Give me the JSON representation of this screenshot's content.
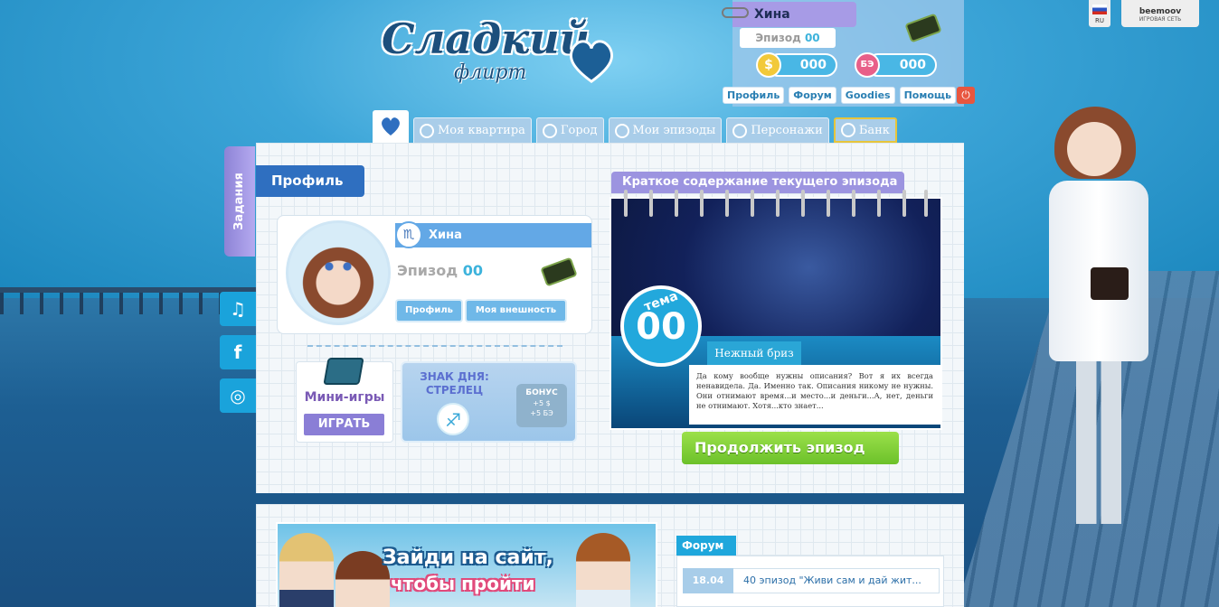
{
  "logo": {
    "title": "Сладкий",
    "subtitle": "флирт"
  },
  "player": {
    "name": "Хина",
    "episode_label": "Эпизод",
    "episode_value": "00",
    "dollars": "000",
    "be": "000",
    "be_icon": "БЭ",
    "coin_icon": "$"
  },
  "top_links": [
    "Профиль",
    "Форум",
    "Goodies",
    "Помощь"
  ],
  "lang": {
    "code": "RU"
  },
  "beemoov": {
    "logo": "beemoov",
    "subtitle": "ИГРОВАЯ СЕТЬ"
  },
  "nav": {
    "tabs": [
      "Моя квартира",
      "Город",
      "Мои эпизоды",
      "Персонажи",
      "Банк"
    ]
  },
  "side": {
    "quests": "Задания",
    "music_icon": "♫",
    "facebook_icon": "f",
    "instagram_icon": "◎"
  },
  "profile": {
    "section_title": "Профиль",
    "name": "Хина",
    "zodiac_icon": "♏",
    "episode_label": "Эпизод",
    "episode_value": "00",
    "btn_profile": "Профиль",
    "btn_appearance": "Моя внешность"
  },
  "minigames": {
    "title": "Мини-игры",
    "play": "ИГРАТЬ"
  },
  "sign": {
    "title_line1": "ЗНАК ДНЯ:",
    "title_line2": "СТРЕЛЕЦ",
    "icon": "♐",
    "bonus_title": "БОНУС",
    "bonus_1": "+5 $",
    "bonus_2": "+5 БЭ"
  },
  "episode": {
    "header": "Краткое содержание текущего эпизода",
    "tema_label": "тема",
    "tema_value": "00",
    "name": "Нежный бриз",
    "description": "Да кому вообще нужны описания? Вот я их всегда ненавидела. Да. Именно так. Описания никому не нужны. Они отнимают время...и место...и деньги...А, нет, деньги не отнимают. Хотя...кто знает...",
    "continue": "Продолжить эпизод"
  },
  "banner": {
    "line1": "Зайди на сайт,",
    "line2": "чтобы пройти"
  },
  "forum": {
    "title": "Форум",
    "items": [
      {
        "date": "18.04",
        "text": "40 эпизод \"Живи сам и дай жит..."
      }
    ]
  },
  "colors": {
    "accent": "#1fa7dc",
    "purple": "#9c94e0",
    "green": "#7ccd33",
    "blue": "#2f6fc0"
  }
}
